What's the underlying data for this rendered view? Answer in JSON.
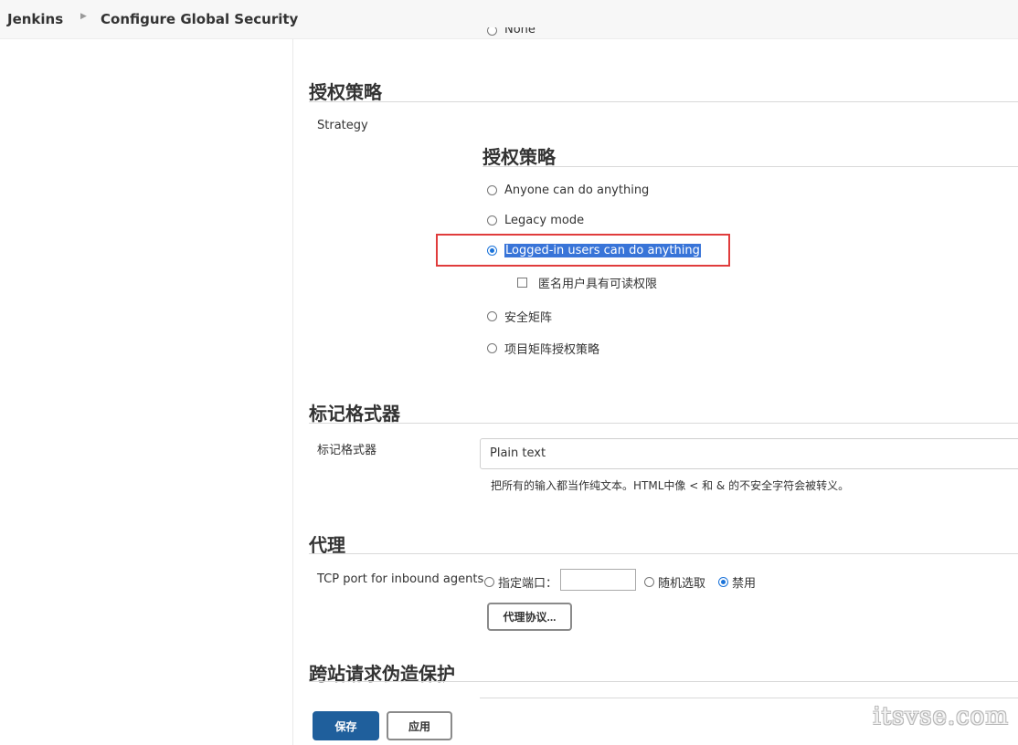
{
  "breadcrumb": {
    "home": "Jenkins",
    "current": "Configure Global Security"
  },
  "partial_option": "None",
  "authorization": {
    "section_title": "授权策略",
    "strategy_label": "Strategy",
    "inner_title": "授权策略",
    "options": [
      {
        "label": "Anyone can do anything",
        "checked": false
      },
      {
        "label": "Legacy mode",
        "checked": false
      },
      {
        "label": "Logged-in users can do anything",
        "checked": true
      },
      {
        "label": "安全矩阵",
        "checked": false
      },
      {
        "label": "项目矩阵授权策略",
        "checked": false
      }
    ],
    "anonymous_read_label": "匿名用户具有可读权限",
    "anonymous_read_checked": false
  },
  "markup": {
    "section_title": "标记格式器",
    "label": "标记格式器",
    "selected": "Plain text",
    "description": "把所有的输入都当作纯文本。HTML中像 < 和 & 的不安全字符会被转义。"
  },
  "proxy": {
    "section_title": "代理",
    "tcp_label": "TCP port for inbound agents",
    "fixed_label": "指定端口：",
    "fixed_value": "",
    "random_label": "随机选取",
    "disable_label": "禁用",
    "selected": "disable",
    "protocols_button": "代理协议..."
  },
  "csrf": {
    "section_title": "跨站请求伪造保护"
  },
  "actions": {
    "save": "保存",
    "apply": "应用"
  },
  "watermark": "itsvse.com",
  "colors": {
    "accent": "#1a73d9",
    "highlight": "#e03c3c",
    "primary_button": "#1f5f9c",
    "selection": "#3874d8"
  }
}
